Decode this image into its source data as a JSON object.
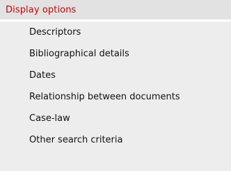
{
  "panel": {
    "title": "Display options",
    "colors": {
      "title_text": "#d40000",
      "header_background": "#e2e2e2",
      "panel_background": "#ededed",
      "item_text": "#111111"
    },
    "items": [
      {
        "label": "Descriptors"
      },
      {
        "label": "Bibliographical details"
      },
      {
        "label": "Dates"
      },
      {
        "label": "Relationship between documents"
      },
      {
        "label": "Case-law"
      },
      {
        "label": "Other search criteria"
      }
    ]
  }
}
